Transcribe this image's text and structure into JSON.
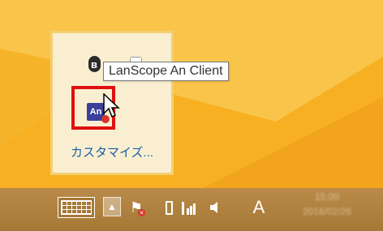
{
  "tooltip": {
    "text": "LanScope An Client"
  },
  "tray": {
    "an_label": "An",
    "customize_label": "カスタマイズ..."
  },
  "taskbar": {
    "ime_label": "A",
    "clock_time": "15:00",
    "clock_date": "2016/02/26",
    "show_hidden_glyph": "▲"
  },
  "colors": {
    "wallpaper": "#f6b021",
    "taskbar": "#a67835",
    "popup_bg": "#f9efd0",
    "highlight": "#e01010",
    "link": "#1b5ea8"
  }
}
